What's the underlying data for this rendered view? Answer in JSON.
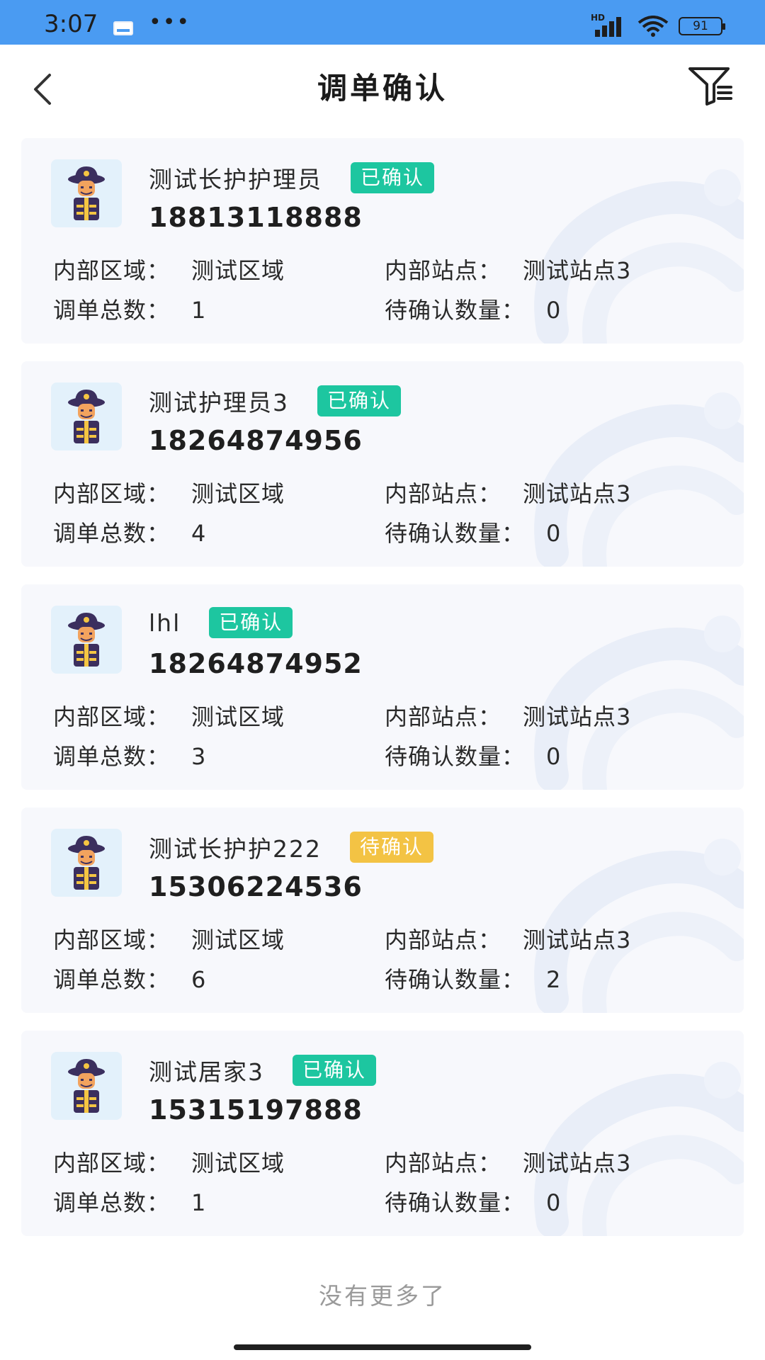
{
  "status_bar": {
    "time": "3:07",
    "dots": "•••",
    "battery": "91",
    "network_label": "HD",
    "colors": {
      "background": "#4a9bf2"
    }
  },
  "header": {
    "title": "调单确认",
    "back_icon": "chevron-left-icon",
    "filter_icon": "filter-icon"
  },
  "labels": {
    "area": "内部区域：",
    "station": "内部站点：",
    "total": "调单总数：",
    "pending_count": "待确认数量："
  },
  "cards": [
    {
      "name": "测试长护护理员",
      "status": "已确认",
      "status_type": "confirmed",
      "phone": "18813118888",
      "area": "测试区域",
      "station": "测试站点3",
      "total": "1",
      "pending": "0"
    },
    {
      "name": "测试护理员3",
      "status": "已确认",
      "status_type": "confirmed",
      "phone": "18264874956",
      "area": "测试区域",
      "station": "测试站点3",
      "total": "4",
      "pending": "0"
    },
    {
      "name": "lhl",
      "status": "已确认",
      "status_type": "confirmed",
      "phone": "18264874952",
      "area": "测试区域",
      "station": "测试站点3",
      "total": "3",
      "pending": "0"
    },
    {
      "name": "测试长护护222",
      "status": "待确认",
      "status_type": "pending",
      "phone": "15306224536",
      "area": "测试区域",
      "station": "测试站点3",
      "total": "6",
      "pending": "2"
    },
    {
      "name": "测试居家3",
      "status": "已确认",
      "status_type": "confirmed",
      "phone": "15315197888",
      "area": "测试区域",
      "station": "测试站点3",
      "total": "1",
      "pending": "0"
    }
  ],
  "footer": {
    "no_more": "没有更多了"
  },
  "colors": {
    "confirmed": "#1dc6a0",
    "pending": "#f3c344",
    "card_bg": "#f7f8fc"
  }
}
